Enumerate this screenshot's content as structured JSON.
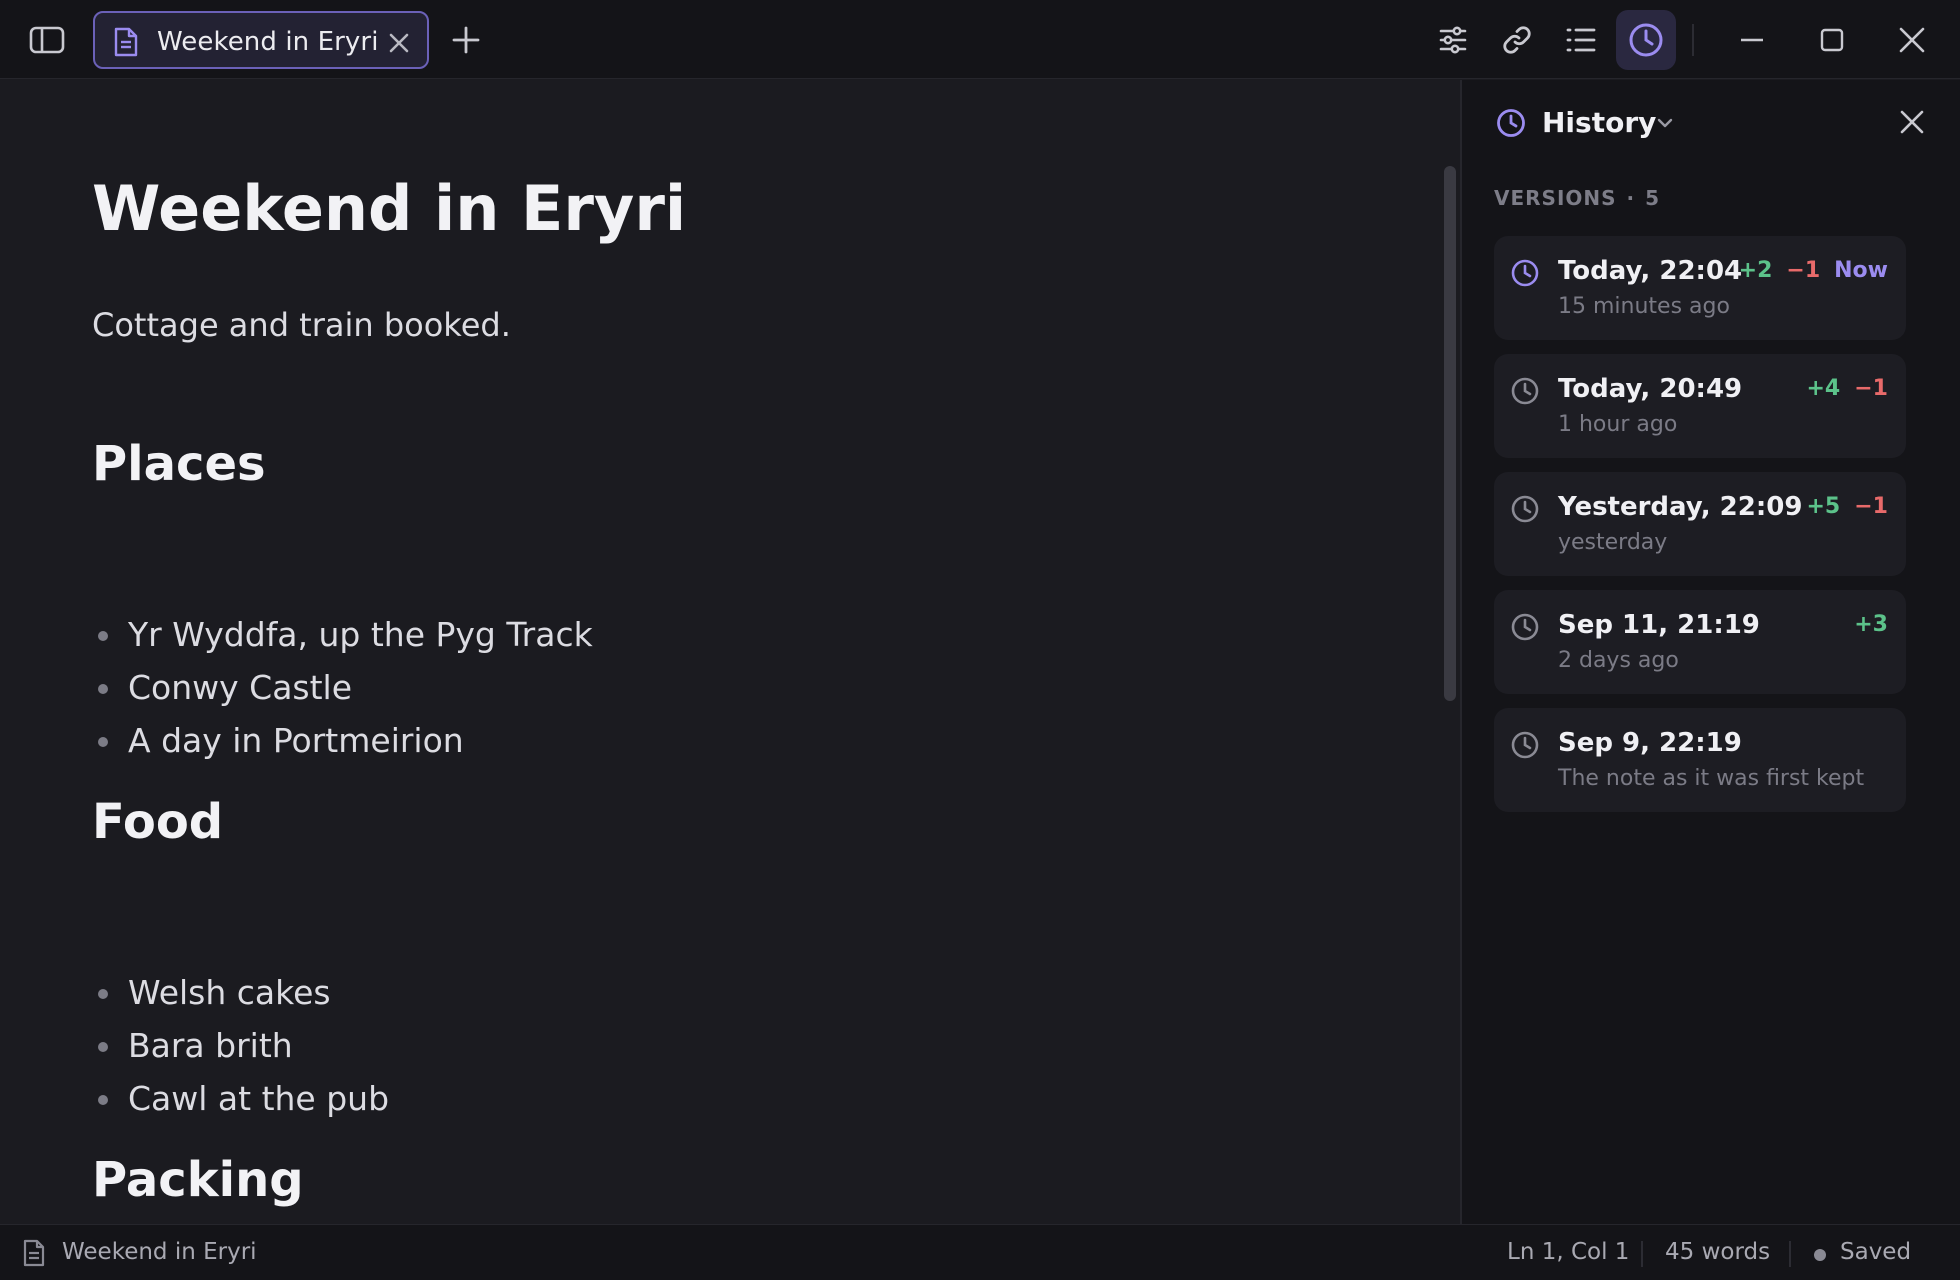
{
  "colors": {
    "accent": "#9b8cf0",
    "additions": "#5cc28a",
    "deletions": "#e86a6a",
    "background": "#1b1b20"
  },
  "titlebar": {
    "tab": {
      "label": "Weekend in Eryri",
      "icon": "document-icon"
    },
    "icons": [
      "sidebar-toggle-icon",
      "plus-icon",
      "sliders-icon",
      "link-icon",
      "list-icon",
      "clock-icon",
      "minimize-icon",
      "maximize-icon",
      "close-icon"
    ]
  },
  "editor": {
    "title": "Weekend in Eryri",
    "paragraph": "Cottage and train booked.",
    "sections": [
      {
        "heading": "Places",
        "items": [
          "Yr Wyddfa, up the Pyg Track",
          "Conwy Castle",
          "A day in Portmeirion"
        ]
      },
      {
        "heading": "Food",
        "items": [
          "Welsh cakes",
          "Bara brith",
          "Cawl at the pub"
        ]
      },
      {
        "heading": "Packing",
        "items": []
      }
    ]
  },
  "history": {
    "title": "History",
    "versions_label": "VERSIONS",
    "versions_count": "5",
    "versions": [
      {
        "title": "Today, 22:04",
        "subtitle": "15 minutes ago",
        "added": "+2",
        "removed": "−1",
        "badge": "Now",
        "current": true
      },
      {
        "title": "Today, 20:49",
        "subtitle": "1 hour ago",
        "added": "+4",
        "removed": "−1",
        "badge": "",
        "current": false
      },
      {
        "title": "Yesterday, 22:09",
        "subtitle": "yesterday",
        "added": "+5",
        "removed": "−1",
        "badge": "",
        "current": false
      },
      {
        "title": "Sep 11, 21:19",
        "subtitle": "2 days ago",
        "added": "+3",
        "removed": "",
        "badge": "",
        "current": false
      },
      {
        "title": "Sep 9, 22:19",
        "subtitle": "The note as it was first kept",
        "added": "",
        "removed": "",
        "badge": "",
        "current": false
      }
    ]
  },
  "statusbar": {
    "filename": "Weekend in Eryri",
    "position": "Ln 1, Col 1",
    "words": "45 words",
    "saved": "Saved"
  }
}
